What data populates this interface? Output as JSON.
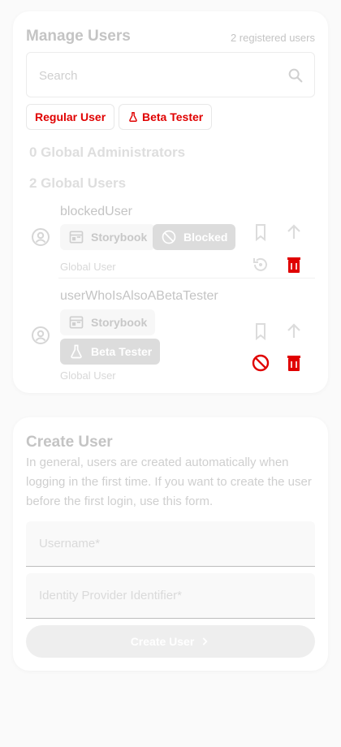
{
  "manage": {
    "title": "Manage Users",
    "count": "2 registered users",
    "search_placeholder": "Search",
    "filters": [
      {
        "label": "Regular User",
        "icon": "none"
      },
      {
        "label": "Beta Tester",
        "icon": "flask-icon"
      }
    ],
    "admins_heading": "0 Global Administrators",
    "users_heading": "2 Global Users",
    "users": [
      {
        "name": "blockedUser",
        "chips": [
          {
            "label": "Storybook",
            "icon": "storybook-icon"
          },
          {
            "label": "Blocked",
            "icon": "blocked-icon"
          }
        ],
        "role": "Global User",
        "actions": [
          "bookmark-icon",
          "arrow-up-icon",
          "restore-icon",
          "delete-icon"
        ]
      },
      {
        "name": "userWhoIsAlsoABetaTester",
        "chips": [
          {
            "label": "Storybook",
            "icon": "storybook-icon"
          },
          {
            "label": "Beta Tester",
            "icon": "flask-icon"
          }
        ],
        "role": "Global User",
        "actions": [
          "bookmark-icon",
          "arrow-up-icon",
          "block-icon",
          "delete-icon"
        ]
      }
    ]
  },
  "create": {
    "title": "Create User",
    "description": "In general, users are created automatically when logging in the first time. If you want to create the user before the first login, use this form.",
    "username_placeholder": "Username*",
    "idp_placeholder": "Identity Provider Identifier*",
    "button_label": "Create User"
  },
  "colors": {
    "accent_red": "#e00000",
    "muted_text": "#c4c4c4",
    "card_bg": "#ffffff"
  }
}
